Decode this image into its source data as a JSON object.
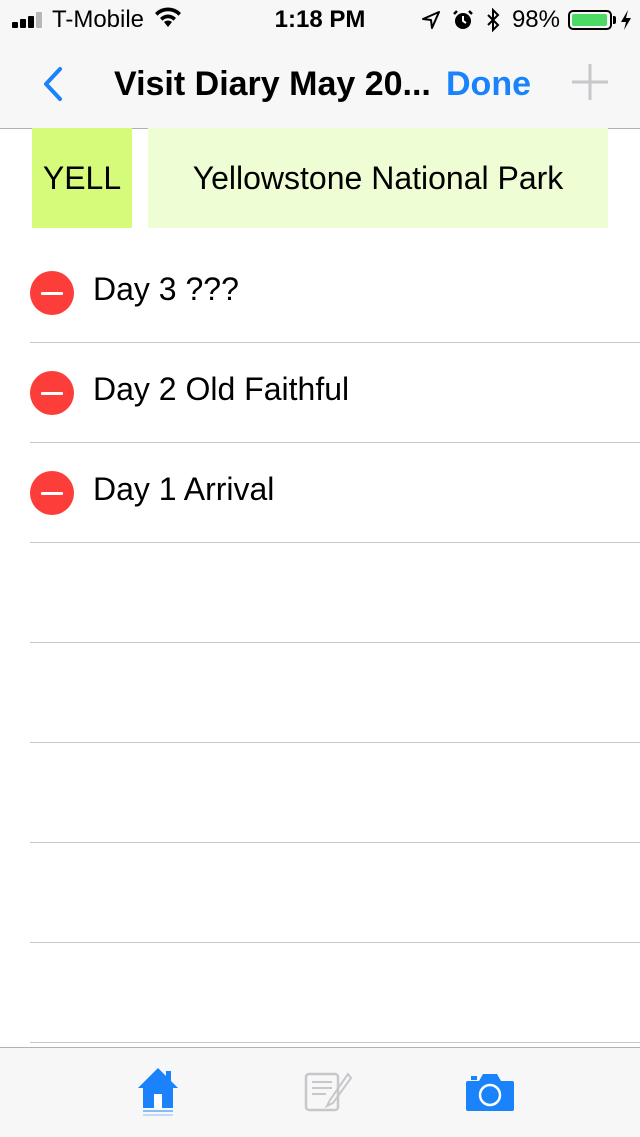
{
  "status_bar": {
    "carrier": "T-Mobile",
    "time": "1:18 PM",
    "battery": "98%",
    "battery_level": 0.98,
    "battery_color": "#4cd964",
    "icons": [
      "signal-icon",
      "wifi-icon",
      "location-icon",
      "alarm-icon",
      "bluetooth-icon",
      "battery-icon",
      "charging-icon"
    ]
  },
  "nav": {
    "title": "Visit Diary May 20...",
    "done_label": "Done",
    "accent_color": "#1a82fb",
    "icons": [
      "chevron-left-icon",
      "plus-icon"
    ]
  },
  "park": {
    "code": "YELL",
    "name": "Yellowstone National Park",
    "code_color": "#d6fb7a",
    "name_color": "#effdd4"
  },
  "entries": [
    {
      "label": "Day 3 ???"
    },
    {
      "label": "Day 2 Old Faithful"
    },
    {
      "label": "Day 1 Arrival"
    },
    {
      "label": ""
    },
    {
      "label": ""
    },
    {
      "label": ""
    },
    {
      "label": ""
    },
    {
      "label": ""
    }
  ],
  "delete_color": "#fc3d39",
  "tab_bar": {
    "tabs": [
      {
        "icon": "home-icon",
        "active": true
      },
      {
        "icon": "notes-icon",
        "active": false
      },
      {
        "icon": "camera-icon",
        "active": true
      }
    ]
  }
}
